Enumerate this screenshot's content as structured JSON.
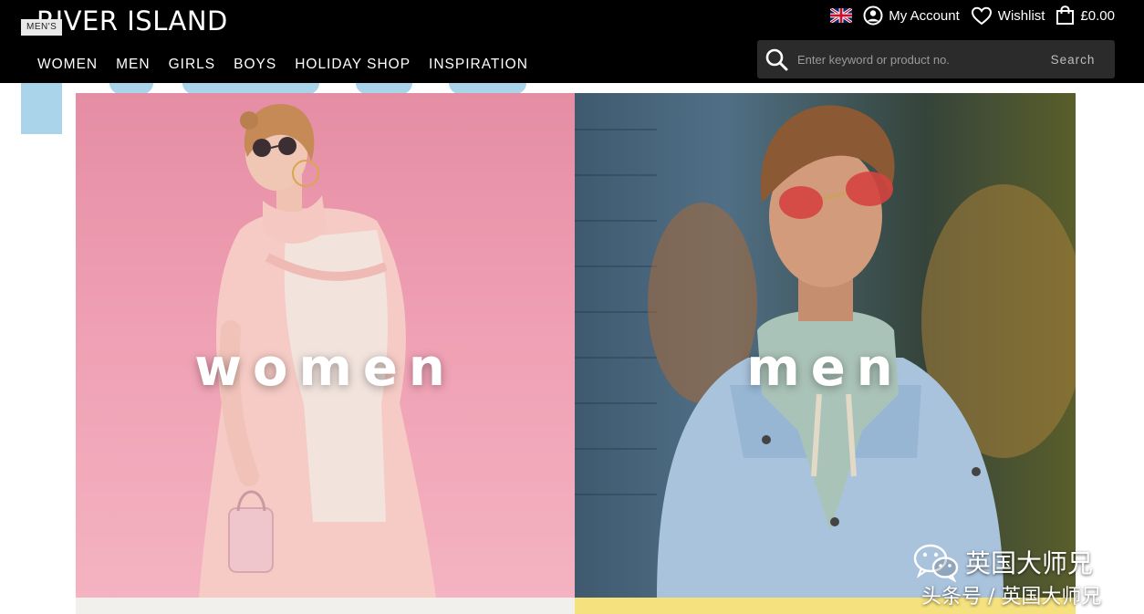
{
  "header": {
    "logo": "RIVER ISLAND",
    "section_badge": "MEN'S",
    "nav": [
      "WOMEN",
      "MEN",
      "GIRLS",
      "BOYS",
      "HOLIDAY SHOP",
      "INSPIRATION"
    ],
    "utility": {
      "country_flag": "uk-flag-icon",
      "account_label": "My Account",
      "wishlist_label": "Wishlist",
      "bag_total": "£0.00"
    },
    "search": {
      "placeholder": "Enter keyword or product no.",
      "button_label": "Search"
    }
  },
  "hero": {
    "women_label": "women",
    "men_label": "men"
  },
  "watermark": {
    "line1": "英国大师兄",
    "line2": "头条号 / 英国大师兄",
    "icon": "wechat-icon"
  },
  "colors": {
    "header_bg": "#000000",
    "accent_blue": "#a9d4ea",
    "women_panel": "#ef9fb3",
    "search_bg": "#2b2b2b"
  }
}
